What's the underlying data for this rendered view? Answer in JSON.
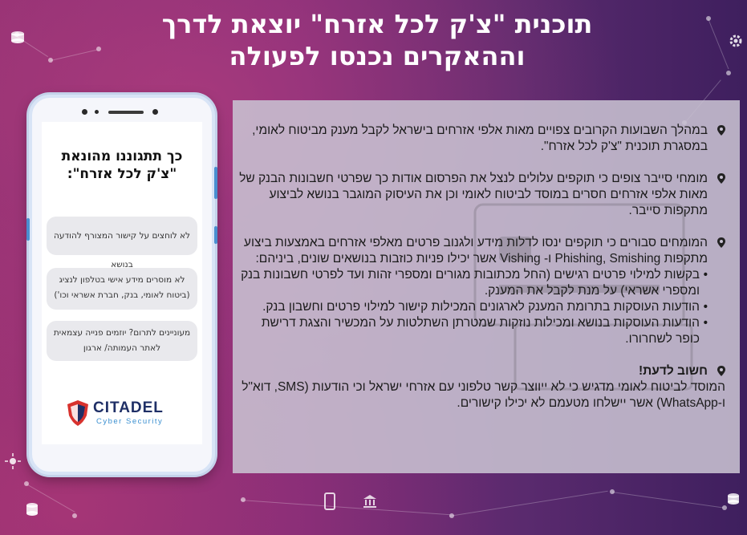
{
  "title": {
    "line1": "תוכנית \"צ'ק לכל אזרח\" יוצאת לדרך",
    "line2": "וההאקרים נכנסו לפעולה"
  },
  "phone": {
    "heading_line1": "כך תתגוננו מהונאת",
    "heading_line2": "\"צ'ק לכל אזרח\":",
    "bubbles": [
      "לא לוחצים על קישור המצורף להודעה בנושא",
      "לא מוסרים מידע אישי בטלפון לנציג (ביטוח לאומי, בנק, חברת אשראי וכו')",
      "מעוניינים לתרום? יוזמים פנייה עצמאית לאתר העמותה/ ארגון"
    ],
    "logo": {
      "name": "CITADEL",
      "tagline": "Cyber Security",
      "icon": "shield-icon"
    }
  },
  "panel": {
    "p1": "במהלך השבועות הקרובים צפויים מאות אלפי אזרחים בישראל לקבל מענק מביטוח לאומי, במסגרת תוכנית \"צ'ק לכל אזרח\".",
    "p2": "מומחי סייבר צופים כי תוקפים עלולים לנצל את הפרסום אודות כך שפרטי חשבונות הבנק של מאות אלפי אזרחים חסרים במוסד לביטוח לאומי וכן את העיסוק המוגבר בנושא לביצוע מתקפות סייבר.",
    "p3": "המומחים סבורים כי תוקפים ינסו לדלות מידע ולגנוב פרטים מאלפי אזרחים באמצעות ביצוע מתקפות Phishing, Smishing ו- Vishing אשר יכילו פניות כוזבות בנושאים שונים, ביניהם:",
    "bullets": [
      "בקשות למילוי פרטים רגישים (החל מכתובות מגורים ומספרי זהות ועד לפרטי חשבונות בנק ומספרי אשראי) על מנת לקבל את המענק.",
      "הודעות העוסקות בתרומת המענק לארגונים המכילות קישור למילוי פרטים וחשבון בנק.",
      "הודעות העוסקות בנושא ומכילות נוזקות שמטרתן השתלטות על המכשיר והצגת דרישת כופר לשחרורו."
    ],
    "important_label": "חשוב לדעת!",
    "important_text": "המוסד לביטוח לאומי מדגיש כי לא ייווצר קשר טלפוני עם אזרחי ישראל וכי הודעות (SMS, דוא\"ל ו-WhatsApp) אשר יישלחו מטעמם לא יכילו קישורים."
  },
  "colors": {
    "background": "#7a2a78",
    "panel": "#c8c2d2",
    "logo_red": "#d8322e",
    "logo_blue": "#1f2f66"
  }
}
